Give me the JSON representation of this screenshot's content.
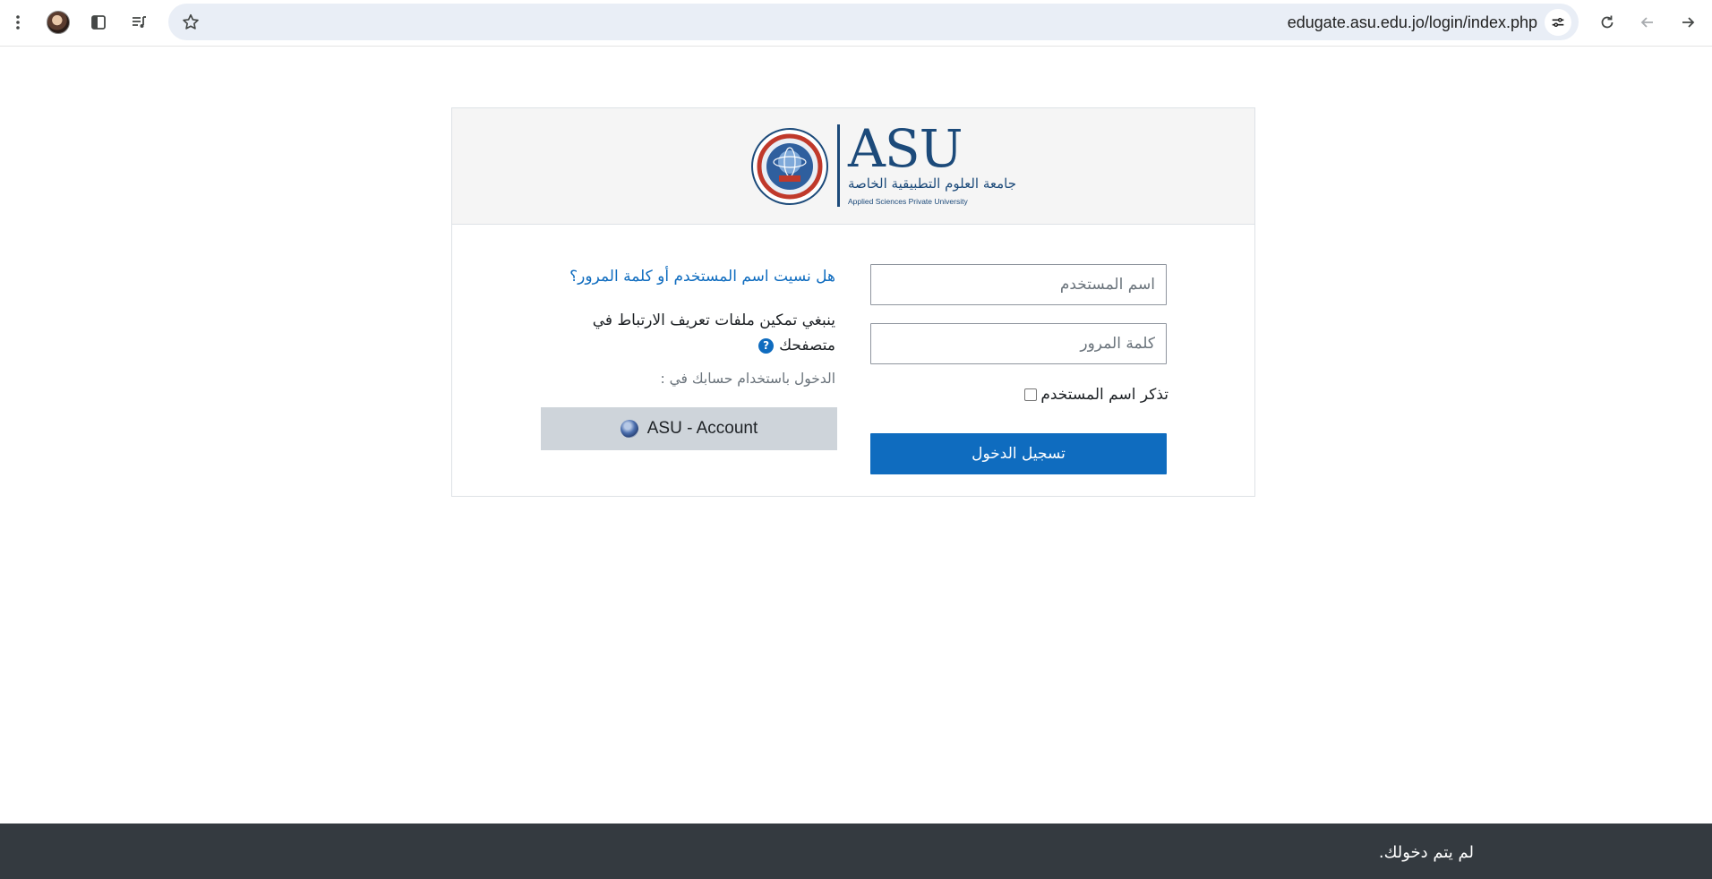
{
  "browser": {
    "url": "edugate.asu.edu.jo/login/index.php",
    "icons": [
      "more-vert-icon",
      "avatar",
      "side-panel-icon",
      "reading-list-icon",
      "star-icon",
      "tune-icon",
      "reload-icon",
      "back-icon",
      "forward-icon"
    ]
  },
  "logo": {
    "mark": "ASU",
    "arabic_name": "جامعة العلوم التطبيقية الخاصة",
    "english_name": "Applied Sciences Private University"
  },
  "login_form": {
    "username_placeholder": "اسم المستخدم",
    "password_placeholder": "كلمة المرور",
    "remember_label": "تذكر اسم المستخدم",
    "remember_checked": false,
    "submit_label": "تسجيل الدخول"
  },
  "info": {
    "forgot_link": "هل نسيت اسم المستخدم أو كلمة المرور؟",
    "cookies_notice": "ينبغي تمكين ملفات تعريف الارتباط في متصفحك",
    "help_icon_glyph": "?",
    "login_via": "الدخول باستخدام حسابك في :",
    "sso_button_label": "ASU - Account"
  },
  "footer": {
    "status": "لم يتم دخولك."
  },
  "colors": {
    "primary": "#0f6cbf",
    "footer_bg": "#343a40",
    "header_bg": "#f5f5f5",
    "sso_bg": "#ced4da",
    "logo_blue": "#1c4a7a"
  }
}
